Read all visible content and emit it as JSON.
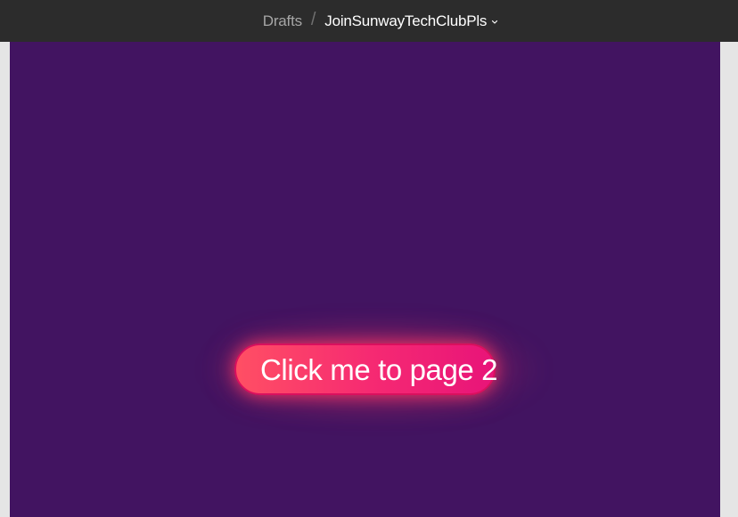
{
  "topbar": {
    "breadcrumb": {
      "parent": "Drafts",
      "separator": "/",
      "file_name": "JoinSunwayTechClubPls",
      "dropdown_icon": "chevron-down-icon"
    }
  },
  "canvas": {
    "frame_background": "#421461",
    "workspace_background": "#e5e5e5",
    "button": {
      "label": "Click me to page 2",
      "gradient_start": "#ff4f64",
      "gradient_end": "#e81479",
      "border_color": "#d9105e",
      "text_color": "#ffffff"
    }
  }
}
